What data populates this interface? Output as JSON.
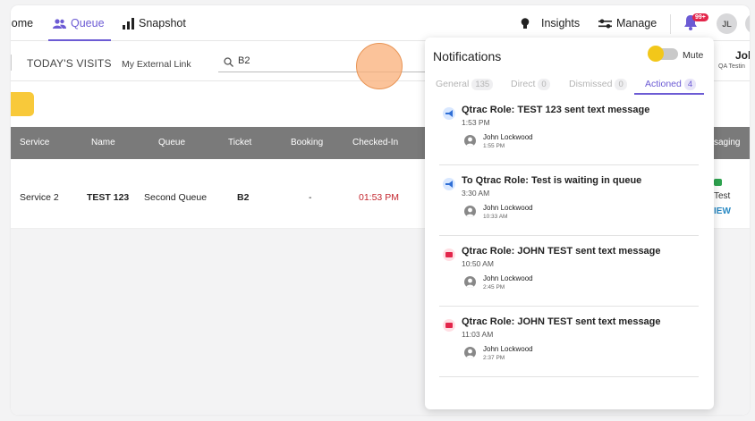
{
  "nav": {
    "home": "lome",
    "queue": "Queue",
    "snapshot": "Snapshot",
    "insights": "Insights",
    "manage": "Manage",
    "bell_badge": "99+",
    "avatar_initials": "JL"
  },
  "subnav": {
    "todays_visits": "TODAY'S VISITS",
    "external_link": "My External Link",
    "search_value": "B2",
    "user_name": "Jol",
    "user_sub": "QA Testin"
  },
  "table": {
    "headers": [
      "Service",
      "Name",
      "Queue",
      "Ticket",
      "Booking",
      "Checked-In",
      "saging"
    ],
    "row": {
      "service": "Service 2",
      "name": "TEST 123",
      "queue": "Second Queue",
      "ticket": "B2",
      "booking": "-",
      "checked_in": "01:53 PM",
      "messaging_text": "Test",
      "messaging_link": "IEW"
    }
  },
  "notifications": {
    "title": "Notifications",
    "mute_label": "Mute",
    "tabs": [
      {
        "label": "General",
        "count": "135"
      },
      {
        "label": "Direct",
        "count": "0"
      },
      {
        "label": "Dismissed",
        "count": "0"
      },
      {
        "label": "Actioned",
        "count": "4"
      }
    ],
    "items": [
      {
        "title": "Qtrac Role: TEST 123 sent text message",
        "time": "1:53 PM",
        "person": "John Lockwood",
        "person_time": "1:55 PM",
        "icon": "megaphone-icon"
      },
      {
        "title": "To Qtrac Role: Test is waiting in queue",
        "time": "3:30 AM",
        "person": "John Lockwood",
        "person_time": "10:33 AM",
        "icon": "megaphone-icon"
      },
      {
        "title": "Qtrac Role: JOHN TEST sent text message",
        "time": "10:50 AM",
        "person": "John Lockwood",
        "person_time": "2:45 PM",
        "icon": "message-icon"
      },
      {
        "title": "Qtrac Role: JOHN TEST sent text message",
        "time": "11:03 AM",
        "person": "John Lockwood",
        "person_time": "2:37 PM",
        "icon": "message-icon"
      }
    ]
  },
  "colors": {
    "accent": "#6c5bd4",
    "header_gray": "#7a7a7a",
    "toggle_yellow": "#f2c71a",
    "alert_red": "#e3264b"
  }
}
